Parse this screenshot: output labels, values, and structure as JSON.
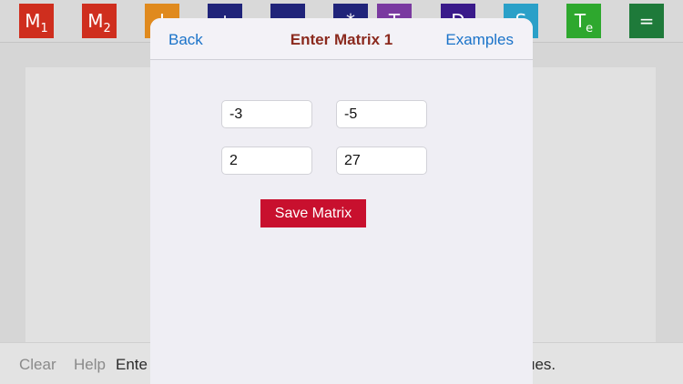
{
  "toolbar": {
    "tools": [
      {
        "name": "matrix-1-tool",
        "label": "M",
        "sub": "1",
        "color": "#cf2e1e"
      },
      {
        "name": "matrix-2-tool",
        "label": "M",
        "sub": "2",
        "color": "#cf2e1e"
      },
      {
        "name": "inverse-tool",
        "label": "I",
        "sub": "",
        "color": "#e08a1e"
      },
      {
        "name": "add-tool",
        "label": "+",
        "sub": "",
        "color": "#20247a"
      },
      {
        "name": "subtract-tool",
        "label": "−",
        "sub": "",
        "color": "#20247a"
      },
      {
        "name": "multiply-tool",
        "label": "*",
        "sub": "",
        "color": "#20247a"
      },
      {
        "name": "transpose-tool",
        "label": "T",
        "sub": "",
        "color": "#7a3aa0"
      },
      {
        "name": "determinant-tool",
        "label": "D",
        "sub": "",
        "color": "#3a1a8a"
      },
      {
        "name": "solve-tool",
        "label": "S",
        "sub": "",
        "color": "#2aa0c8"
      },
      {
        "name": "echelon-tool",
        "label": "T",
        "sub": "e",
        "color": "#2ea82e"
      },
      {
        "name": "equals-tool",
        "label": "=",
        "sub": "",
        "color": "#1e7a3a"
      }
    ]
  },
  "bottombar": {
    "clear": "Clear",
    "help": "Help",
    "message_start": "Ente",
    "message_end": "ues."
  },
  "sheet": {
    "back": "Back",
    "title": "Enter Matrix 1",
    "examples": "Examples",
    "matrix": [
      [
        "-3",
        "-5"
      ],
      [
        "2",
        "27"
      ]
    ],
    "save_label": "Save Matrix"
  },
  "colors": {
    "link": "#1a73c9",
    "title": "#8b2a1e",
    "save_button": "#c8102e",
    "sheet_background": "#efeef4"
  }
}
